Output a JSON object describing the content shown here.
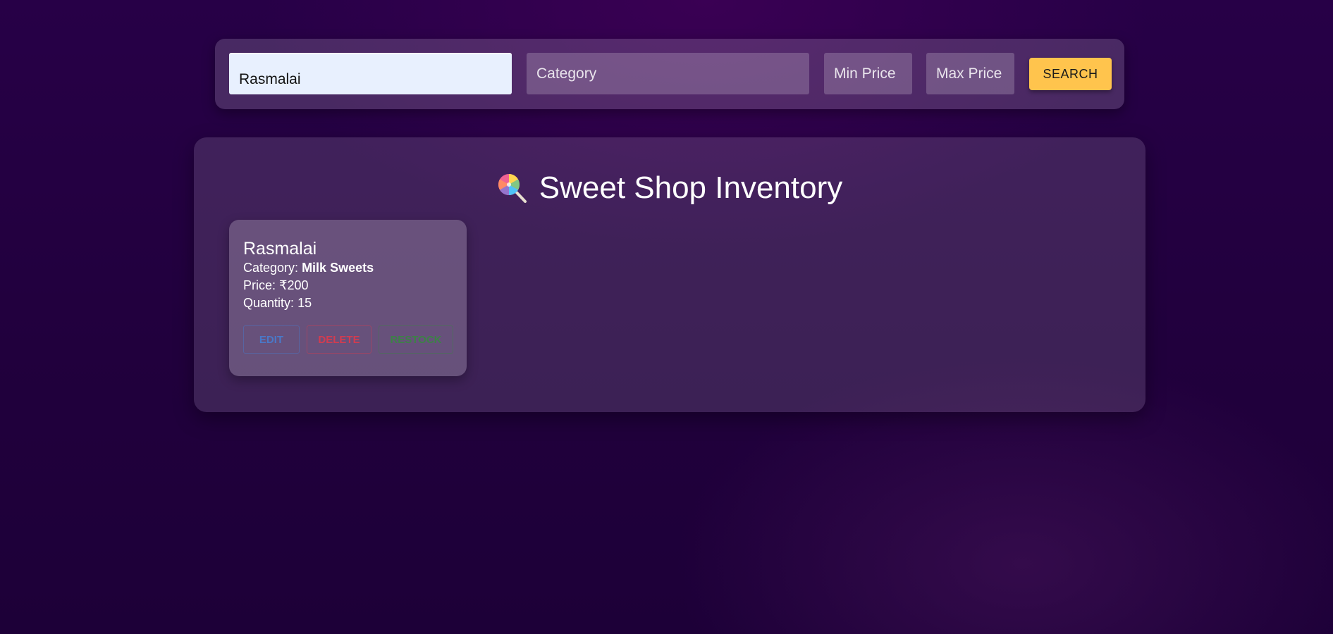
{
  "search": {
    "name_value": "Rasmalai",
    "category_placeholder": "Category",
    "min_price_placeholder": "Min Price",
    "max_price_placeholder": "Max Price",
    "search_label": "SEARCH"
  },
  "inventory": {
    "title": "Sweet Shop Inventory",
    "title_icon": "lollipop-icon",
    "items": [
      {
        "name": "Rasmalai",
        "category_label": "Category:",
        "category": "Milk Sweets",
        "price_label": "Price:",
        "price": "₹200",
        "quantity_label": "Quantity:",
        "quantity": "15",
        "actions": {
          "edit": "EDIT",
          "delete": "DELETE",
          "restock": "RESTOCK"
        }
      }
    ]
  },
  "colors": {
    "accent": "#ffc44d",
    "edit": "#4a78c8",
    "delete": "#d23c50",
    "restock": "#3c8246"
  }
}
